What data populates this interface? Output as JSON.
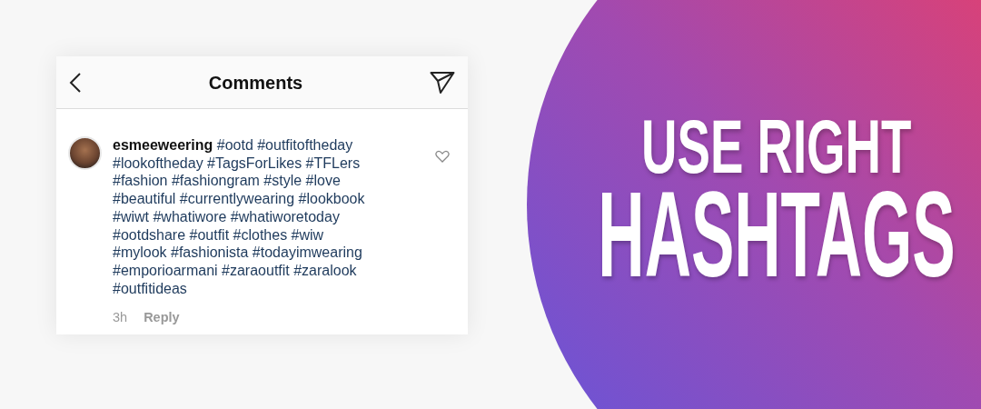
{
  "header": {
    "title": "Comments"
  },
  "comment": {
    "username": "esmeeweering",
    "lines": [
      "#ootd #outfitoftheday",
      "#lookoftheday #TagsForLikes #TFLers",
      "#fashion #fashiongram #style #love",
      "#beautiful #currentlywearing #lookbook",
      "#wiwt #whatiwore #whatiworetoday",
      "#ootdshare #outfit #clothes #wiw",
      "#mylook #fashionista #todayimwearing",
      "#emporioarmani #zaraoutfit #zaralook",
      "#outfitideas"
    ],
    "liked": false,
    "time": "3h",
    "reply": "Reply"
  },
  "headline": [
    "USE RIGHT",
    "HASHTAGS"
  ]
}
